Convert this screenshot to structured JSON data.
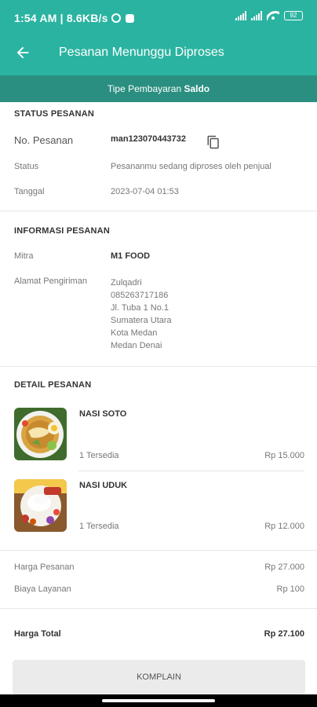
{
  "status_bar": {
    "time_text": "1:54 AM | 8.6KB/s",
    "battery": "92"
  },
  "app_bar": {
    "title": "Pesanan Menunggu Diproses"
  },
  "payment_type": {
    "prefix": "Tipe Pembayaran ",
    "value": "Saldo"
  },
  "order_status": {
    "section_title": "STATUS PESANAN",
    "order_no_label": "No. Pesanan",
    "order_no": "man123070443732",
    "status_label": "Status",
    "status_value": "Pesananmu sedang diproses oleh penjual",
    "date_label": "Tanggal",
    "date_value": "2023-07-04 01:53"
  },
  "order_info": {
    "section_title": "INFORMASI PESANAN",
    "partner_label": "Mitra",
    "partner_value": "M1 FOOD",
    "address_label": "Alamat Pengiriman",
    "address_lines": [
      "Zulqadri",
      "085263717186",
      "Jl. Tuba 1 No.1",
      "Sumatera Utara",
      "Kota Medan",
      "Medan Denai"
    ]
  },
  "order_detail": {
    "section_title": "DETAIL PESANAN",
    "items": [
      {
        "name": "NASI SOTO",
        "qty": "1 Tersedia",
        "price": "Rp 15.000"
      },
      {
        "name": "NASI UDUK",
        "qty": "1 Tersedia",
        "price": "Rp 12.000"
      }
    ]
  },
  "summary": {
    "order_price_label": "Harga Pesanan",
    "order_price": "Rp 27.000",
    "service_fee_label": "Biaya Layanan",
    "service_fee": "Rp 100",
    "total_label": "Harga Total",
    "total": "Rp 27.100"
  },
  "actions": {
    "complain_label": "KOMPLAIN"
  },
  "colors": {
    "primary": "#2bb3a1",
    "primary_dark": "#2a8f80"
  }
}
